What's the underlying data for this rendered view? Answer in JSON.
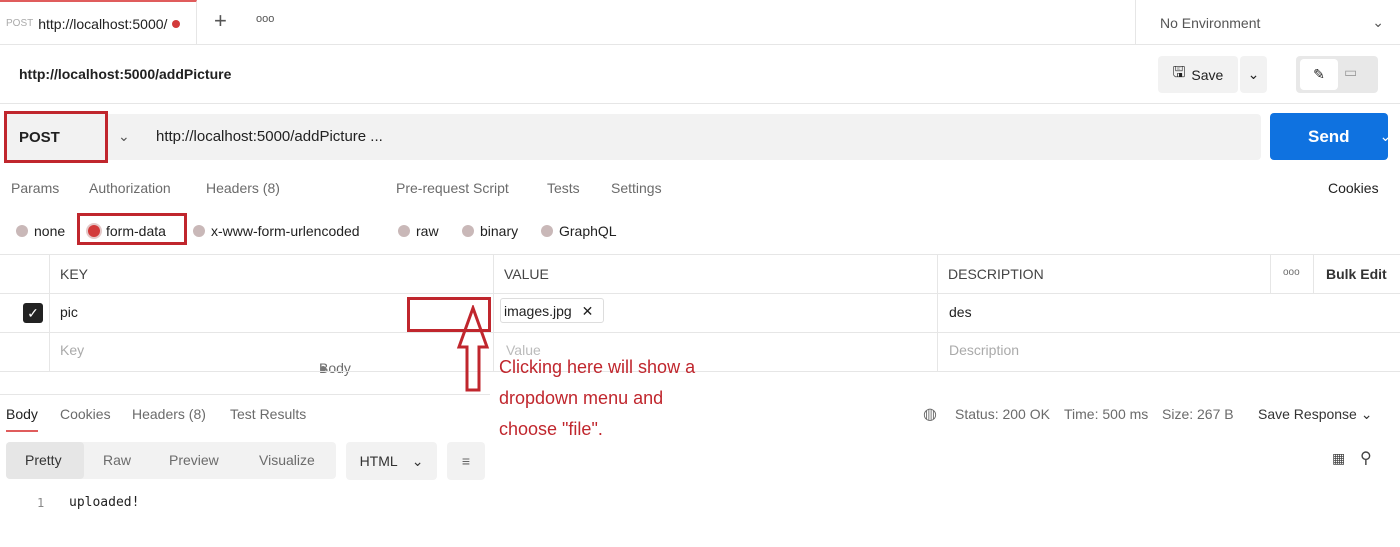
{
  "tabbar": {
    "tab_method": "POST",
    "tab_title": "http://localhost:5000/",
    "new_tab": "+",
    "more": "ooo",
    "environment": "No Environment"
  },
  "request": {
    "title": "http://localhost:5000/addPicture",
    "save": "Save",
    "method": "POST",
    "url": "http://localhost:5000/addPicture ...",
    "send": "Send"
  },
  "req_tabs": [
    "Params",
    "Authorization",
    "Headers (8)",
    "Body",
    "Pre-request Script",
    "Tests",
    "Settings"
  ],
  "cookies": "Cookies",
  "body_types": [
    "none",
    "form-data",
    "x-www-form-urlencoded",
    "raw",
    "binary",
    "GraphQL"
  ],
  "table": {
    "headers": [
      "KEY",
      "VALUE",
      "DESCRIPTION"
    ],
    "bulk_edit": "Bulk Edit",
    "more": "ooo",
    "rows": [
      {
        "checked": true,
        "key": "pic",
        "value": "images.jpg",
        "description": "des"
      }
    ],
    "placeholders": {
      "key": "Key",
      "value": "Value",
      "description": "Description"
    }
  },
  "annotation": {
    "line1": "Clicking here will show a",
    "line2": "dropdown menu and",
    "line3": "choose \"file\".",
    "color": "#c0262d"
  },
  "response": {
    "tabs": [
      "Body",
      "Cookies",
      "Headers (8)",
      "Test Results"
    ],
    "status": "Status: 200 OK",
    "time": "Time: 500 ms",
    "size": "Size: 267 B",
    "save_response": "Save Response",
    "views": [
      "Pretty",
      "Raw",
      "Preview",
      "Visualize"
    ],
    "format": "HTML",
    "lines": [
      {
        "n": "1",
        "text": "uploaded!"
      }
    ]
  },
  "colors": {
    "accent": "#0f72e0",
    "highlight": "#c0262d"
  }
}
